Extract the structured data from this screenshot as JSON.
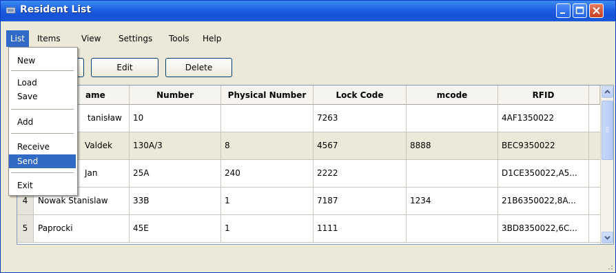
{
  "window": {
    "title": "Resident List",
    "accent": "#1d5fe0"
  },
  "menubar": {
    "items": [
      {
        "label": "List"
      },
      {
        "label": "Items"
      },
      {
        "label": "View"
      },
      {
        "label": "Settings"
      },
      {
        "label": "Tools"
      },
      {
        "label": "Help"
      }
    ]
  },
  "toolbar": {
    "edit_label": "Edit",
    "delete_label": "Delete"
  },
  "list_menu": {
    "items": [
      {
        "label": "New"
      },
      {
        "label": "Load"
      },
      {
        "label": "Save"
      },
      {
        "label": "Add"
      },
      {
        "label": "Receive"
      },
      {
        "label": "Send"
      },
      {
        "label": "Exit"
      }
    ],
    "highlighted": "Send"
  },
  "table": {
    "columns": [
      "ame",
      "Number",
      "Physical Number",
      "Lock Code",
      "mcode",
      "RFID"
    ],
    "rows": [
      {
        "num": "",
        "name": "tanisław",
        "number": "10",
        "physical": "",
        "lock": "7263",
        "mcode": "",
        "rfid": "4AF1350022"
      },
      {
        "num": "",
        "name": "Valdek",
        "number": "130A/3",
        "physical": "8",
        "lock": "4567",
        "mcode": "8888",
        "rfid": "BEC9350022"
      },
      {
        "num": "",
        "name": "Jan",
        "number": "25A",
        "physical": "240",
        "lock": "2222",
        "mcode": "",
        "rfid": "D1CE350022,A5..."
      },
      {
        "num": "4",
        "name": "Nowak Stanislaw",
        "number": "33B",
        "physical": "1",
        "lock": "7187",
        "mcode": "1234",
        "rfid": "21B6350022,8A..."
      },
      {
        "num": "5",
        "name": "Paprocki",
        "number": "45E",
        "physical": "1",
        "lock": "1111",
        "mcode": "",
        "rfid": "3BD8350022,6C..."
      }
    ]
  }
}
